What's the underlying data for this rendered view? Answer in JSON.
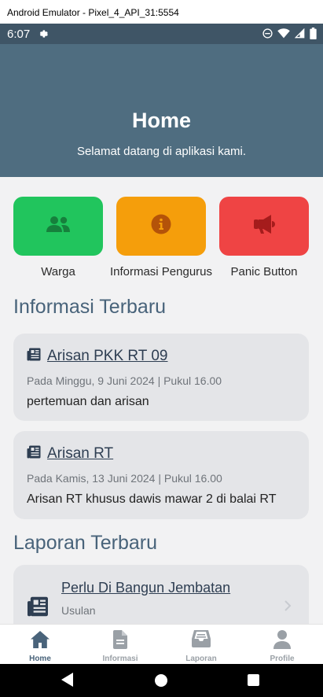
{
  "window": {
    "title": "Android Emulator - Pixel_4_API_31:5554"
  },
  "status_bar": {
    "time": "6:07"
  },
  "header": {
    "title": "Home",
    "subtitle": "Selamat datang di aplikasi kami."
  },
  "quick_actions": [
    {
      "label": "Warga",
      "icon": "people-icon",
      "color": "#21c55d"
    },
    {
      "label": "Informasi Pengurus",
      "icon": "info-icon",
      "color": "#f59e0b"
    },
    {
      "label": "Panic Button",
      "icon": "megaphone-icon",
      "color": "#ef4444"
    }
  ],
  "sections": {
    "info_title": "Informasi Terbaru",
    "report_title": "Laporan Terbaru"
  },
  "info_items": [
    {
      "title": "Arisan PKK RT 09",
      "meta": "Pada Minggu, 9 Juni 2024 | Pukul 16.00",
      "description": "pertemuan dan arisan"
    },
    {
      "title": "Arisan RT",
      "meta": "Pada Kamis, 13 Juni 2024 | Pukul 16.00",
      "description": "Arisan RT khusus dawis mawar 2 di balai RT"
    }
  ],
  "report_items": [
    {
      "title": "Perlu Di Bangun Jembatan",
      "category": "Usulan"
    }
  ],
  "bottom_nav": [
    {
      "label": "Home",
      "icon": "home-icon",
      "active": true
    },
    {
      "label": "Informasi",
      "icon": "document-icon",
      "active": false
    },
    {
      "label": "Laporan",
      "icon": "inbox-icon",
      "active": false
    },
    {
      "label": "Profile",
      "icon": "user-icon",
      "active": false
    }
  ],
  "colors": {
    "header": "#4f6d80",
    "accent": "#49637a"
  }
}
